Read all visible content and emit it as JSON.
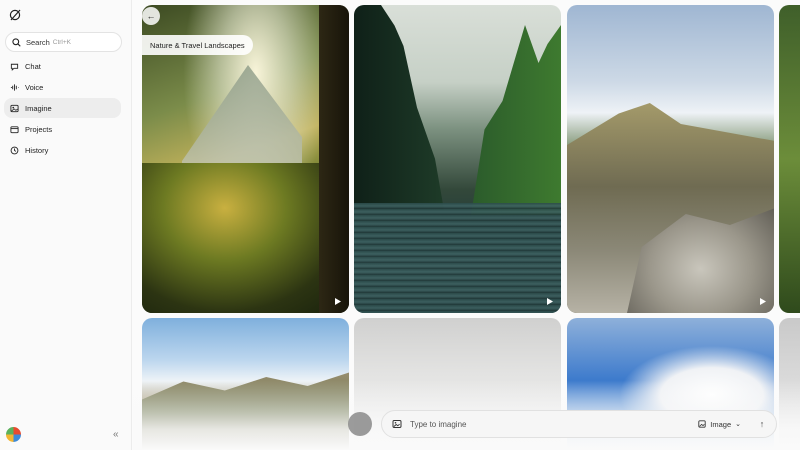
{
  "sidebar": {
    "search": {
      "label": "Search",
      "shortcut": "Ctrl+K"
    },
    "items": [
      {
        "label": "Chat",
        "icon": "chat-icon",
        "active": false
      },
      {
        "label": "Voice",
        "icon": "voice-icon",
        "active": false
      },
      {
        "label": "Imagine",
        "icon": "imagine-icon",
        "active": true
      },
      {
        "label": "Projects",
        "icon": "projects-icon",
        "active": false
      },
      {
        "label": "History",
        "icon": "history-icon",
        "active": false
      }
    ],
    "collapse_glyph": "«"
  },
  "gallery": {
    "title": "Nature & Travel Landscapes",
    "back_glyph": "←",
    "tiles": [
      {
        "name": "forest-sunlight",
        "video": true
      },
      {
        "name": "forest-lake",
        "video": true
      },
      {
        "name": "rocky-ridge",
        "video": true
      },
      {
        "name": "partial-forest",
        "video": false
      },
      {
        "name": "hills-sky",
        "video": false
      },
      {
        "name": "cloudy-sky",
        "video": false
      },
      {
        "name": "blue-sky-clouds",
        "video": false
      },
      {
        "name": "partial-sky",
        "video": false
      }
    ]
  },
  "prompt": {
    "placeholder": "Type to imagine",
    "mode": "Image",
    "mode_chevron": "⌄",
    "send_glyph": "↑"
  },
  "colors": {
    "active_nav": "#ededed",
    "sidebar_bg": "#fafafa",
    "prompt_bg": "#f6f6f6"
  }
}
